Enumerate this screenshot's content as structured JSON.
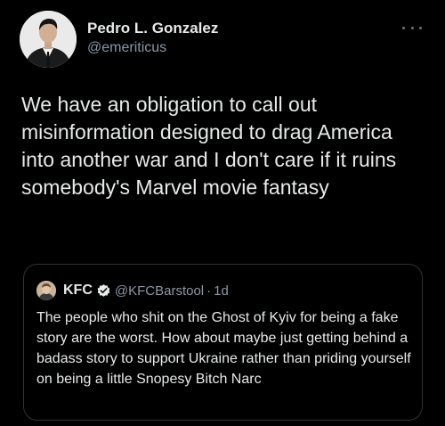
{
  "tweet": {
    "author_name": "Pedro L. Gonzalez",
    "author_handle": "@emeriticus",
    "text": "We have an obligation to call out misinformation designed to drag America into another war and I don't care if it ruins somebody's Marvel movie fantasy",
    "more_icon": "more-horizontal-icon"
  },
  "quoted": {
    "author_name": "KFC",
    "author_handle": "@KFCBarstool",
    "separator": "·",
    "time": "1d",
    "verified_icon": "verified-badge-icon",
    "text": "The people who shit on the Ghost of Kyiv for being a fake story are the worst. How about maybe just getting behind a badass story to support Ukraine rather than priding yourself on being a little Snopesy Bitch Narc"
  },
  "colors": {
    "background": "#000000",
    "text_primary": "#e7e9ea",
    "text_secondary": "#8b98a5",
    "card_border": "#2f3336"
  }
}
